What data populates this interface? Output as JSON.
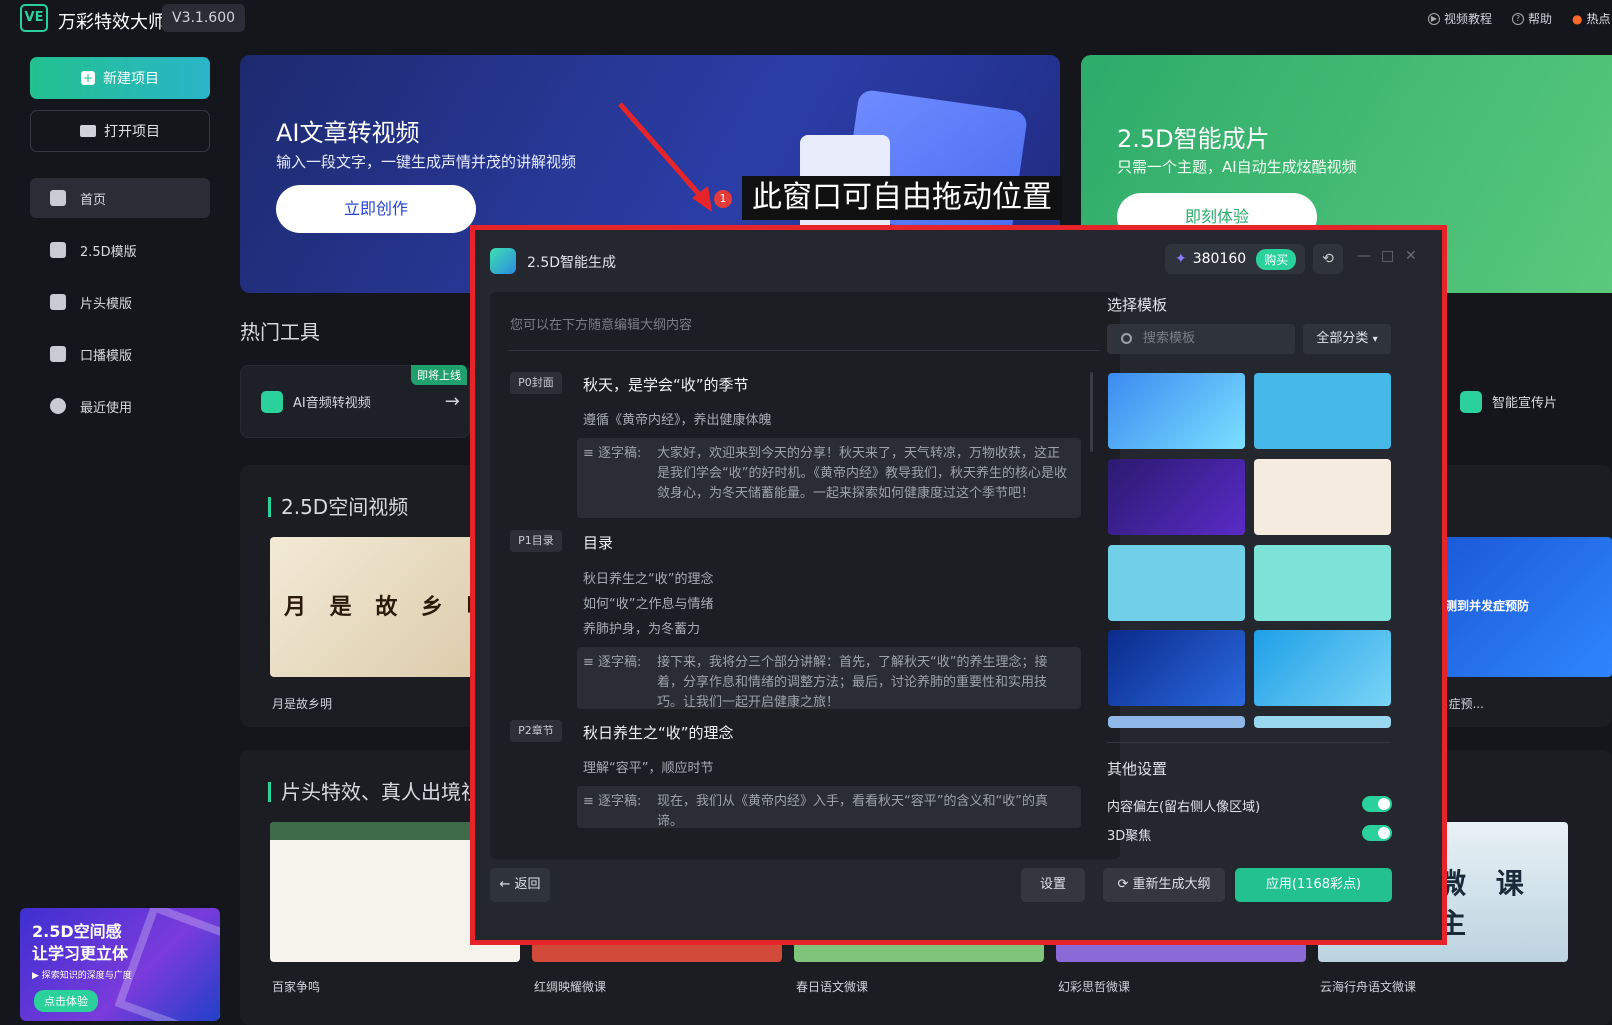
{
  "app": {
    "logo": "VE",
    "name": "万彩特效大师",
    "version": "V3.1.600"
  },
  "topnav": {
    "video_tutorial": "视频教程",
    "help": "帮助",
    "hot": "热点"
  },
  "sidebar": {
    "new_project": "新建项目",
    "open_project": "打开项目",
    "items": [
      {
        "label": "首页",
        "active": true,
        "icon": "home-icon"
      },
      {
        "label": "2.5D模版",
        "icon": "cube-icon"
      },
      {
        "label": "片头模版",
        "icon": "grid-icon"
      },
      {
        "label": "口播模版",
        "icon": "speaker-icon"
      },
      {
        "label": "最近使用",
        "icon": "clock-icon"
      }
    ],
    "promo": {
      "line1": "2.5D空间感",
      "line2": "让学习更立体",
      "line3": "▶ 探索知识的深度与广度",
      "button": "点击体验"
    }
  },
  "banners": [
    {
      "title": "AI文章转视频",
      "subtitle": "输入一段文字，一键生成声情并茂的讲解视频",
      "button": "立即创作"
    },
    {
      "title": "2.5D智能成片",
      "subtitle": "只需一个主题，AI自动生成炫酷视频",
      "button": "即刻体验"
    }
  ],
  "annotation": {
    "badge": "1",
    "text": "此窗口可自由拖动位置"
  },
  "hot_tools": {
    "title": "热门工具",
    "items": [
      {
        "label": "AI音频转视频",
        "tag": "即将上线"
      },
      {
        "label": "智能宣传片"
      }
    ]
  },
  "sections": [
    {
      "title": "2.5D空间视频",
      "cards": [
        {
          "label": "月是故乡明",
          "thumb_text": "月 是 故 乡 明"
        },
        {
          "label": "...症预...",
          "thumb_text": "测到并发症预防"
        }
      ]
    },
    {
      "title": "片头特效、真人出境视",
      "cards": [
        {
          "label": "百家争鸣"
        },
        {
          "label": "红绸映耀微课"
        },
        {
          "label": "春日语文微课"
        },
        {
          "label": "幻彩思哲微课"
        },
        {
          "label": "云海行舟语文微课",
          "thumb_text": "微 课 主"
        }
      ]
    }
  ],
  "dialog": {
    "title": "2.5D智能生成",
    "credits": "380160",
    "buy": "购买",
    "editor_hint": "您可以在下方随意编辑大纲内容",
    "outline": [
      {
        "tag": "P0封面",
        "heading": "秋天，是学会“收”的季节",
        "lines": [
          "遵循《黄帝内经》，养出健康体魄"
        ],
        "script_label": "逐字稿:",
        "script": "大家好，欢迎来到今天的分享！秋天来了，天气转凉，万物收获，这正是我们学会“收”的好时机。《黄帝内经》教导我们，秋天养生的核心是收敛身心，为冬天储蓄能量。一起来探索如何健康度过这个季节吧！"
      },
      {
        "tag": "P1目录",
        "heading": "目录",
        "lines": [
          "秋日养生之“收”的理念",
          "如何“收”之作息与情绪",
          "养肺护身，为冬蓄力"
        ],
        "script_label": "逐字稿:",
        "script": "接下来，我将分三个部分讲解：首先，了解秋天“收”的养生理念；接着，分享作息和情绪的调整方法；最后，讨论养肺的重要性和实用技巧。让我们一起开启健康之旅！"
      },
      {
        "tag": "P2章节",
        "heading": "秋日养生之“收”的理念",
        "lines": [
          "理解“容平”，顺应时节"
        ],
        "script_label": "逐字稿:",
        "script": "现在，我们从《黄帝内经》入手，看看秋天“容平”的含义和“收”的真谛。"
      }
    ],
    "template_title": "选择模板",
    "search_placeholder": "搜索模板",
    "category": "全部分类",
    "other_settings": "其他设置",
    "options": [
      {
        "label": "内容偏左(留右侧人像区域)",
        "on": true
      },
      {
        "label": "3D聚焦",
        "on": true
      }
    ],
    "back": "返回",
    "settings": "设置",
    "regenerate": "重新生成大纲",
    "apply": "应用(1168彩点)"
  }
}
